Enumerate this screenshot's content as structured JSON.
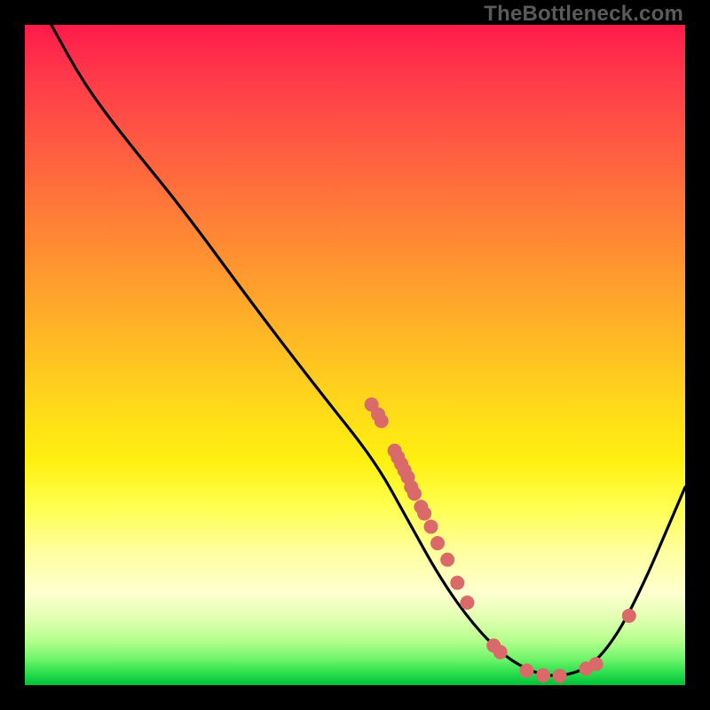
{
  "watermark": "TheBottleneck.com",
  "chart_data": {
    "type": "line",
    "title": "",
    "xlabel": "",
    "ylabel": "",
    "xlim": [
      0,
      100
    ],
    "ylim": [
      0,
      100
    ],
    "curve": [
      {
        "x": 4,
        "y": 100
      },
      {
        "x": 9,
        "y": 91
      },
      {
        "x": 15,
        "y": 83
      },
      {
        "x": 24,
        "y": 72
      },
      {
        "x": 35,
        "y": 57
      },
      {
        "x": 45,
        "y": 44
      },
      {
        "x": 53,
        "y": 34
      },
      {
        "x": 58,
        "y": 25
      },
      {
        "x": 63,
        "y": 16
      },
      {
        "x": 68,
        "y": 9
      },
      {
        "x": 73,
        "y": 4
      },
      {
        "x": 78,
        "y": 1.5
      },
      {
        "x": 82,
        "y": 1.4
      },
      {
        "x": 86,
        "y": 3
      },
      {
        "x": 90,
        "y": 8
      },
      {
        "x": 94,
        "y": 16
      },
      {
        "x": 97,
        "y": 23
      },
      {
        "x": 100,
        "y": 30
      }
    ],
    "markers": [
      {
        "x": 52.5,
        "y": 42.5
      },
      {
        "x": 53.5,
        "y": 41
      },
      {
        "x": 54,
        "y": 40
      },
      {
        "x": 56,
        "y": 35.5
      },
      {
        "x": 56.5,
        "y": 34.5
      },
      {
        "x": 57,
        "y": 33.5
      },
      {
        "x": 57.5,
        "y": 32.5
      },
      {
        "x": 58,
        "y": 31.5
      },
      {
        "x": 58.5,
        "y": 30
      },
      {
        "x": 59,
        "y": 29
      },
      {
        "x": 60,
        "y": 27
      },
      {
        "x": 60.5,
        "y": 26
      },
      {
        "x": 61.5,
        "y": 24
      },
      {
        "x": 62.5,
        "y": 21.5
      },
      {
        "x": 64,
        "y": 19
      },
      {
        "x": 65.5,
        "y": 15.5
      },
      {
        "x": 67,
        "y": 12.5
      },
      {
        "x": 71,
        "y": 6
      },
      {
        "x": 72,
        "y": 5
      },
      {
        "x": 76,
        "y": 2.2
      },
      {
        "x": 78.5,
        "y": 1.5
      },
      {
        "x": 81,
        "y": 1.4
      },
      {
        "x": 85,
        "y": 2.5
      },
      {
        "x": 86.5,
        "y": 3.2
      },
      {
        "x": 91.5,
        "y": 10.5
      }
    ],
    "marker_color": "#d96a69",
    "curve_color": "#000000"
  }
}
